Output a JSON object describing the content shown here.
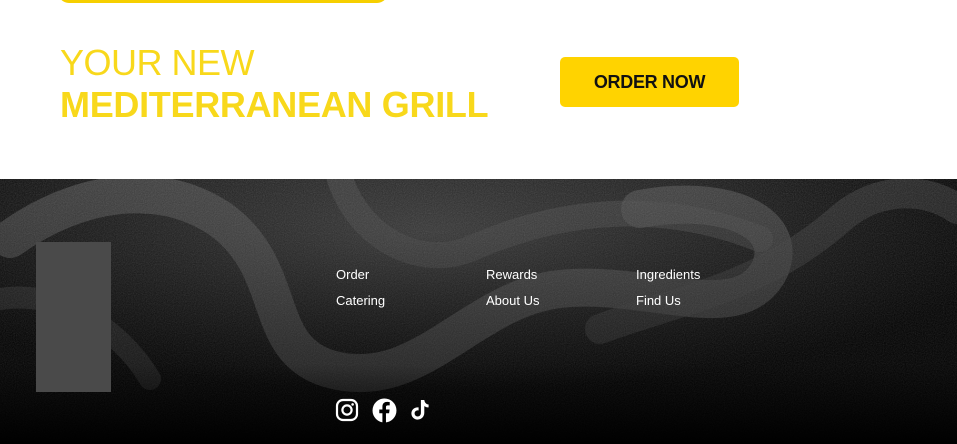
{
  "promo": {
    "headline_line1": "YOUR NEW",
    "headline_line2": "MEDITERRANEAN GRILL",
    "order_button_label": "ORDER NOW"
  },
  "footer": {
    "nav": {
      "column1": [
        "Order",
        "Catering"
      ],
      "column2": [
        "Rewards",
        "About Us"
      ],
      "column3": [
        "Ingredients",
        "Find Us"
      ]
    },
    "social_icons": [
      "instagram-icon",
      "facebook-icon",
      "tiktok-icon"
    ]
  },
  "colors": {
    "accent_yellow": "#ffd300",
    "headline_yellow": "#f8d81b",
    "footer_bg": "#000000",
    "footer_text": "#ffffff",
    "logo_placeholder": "#4a4a4a"
  }
}
